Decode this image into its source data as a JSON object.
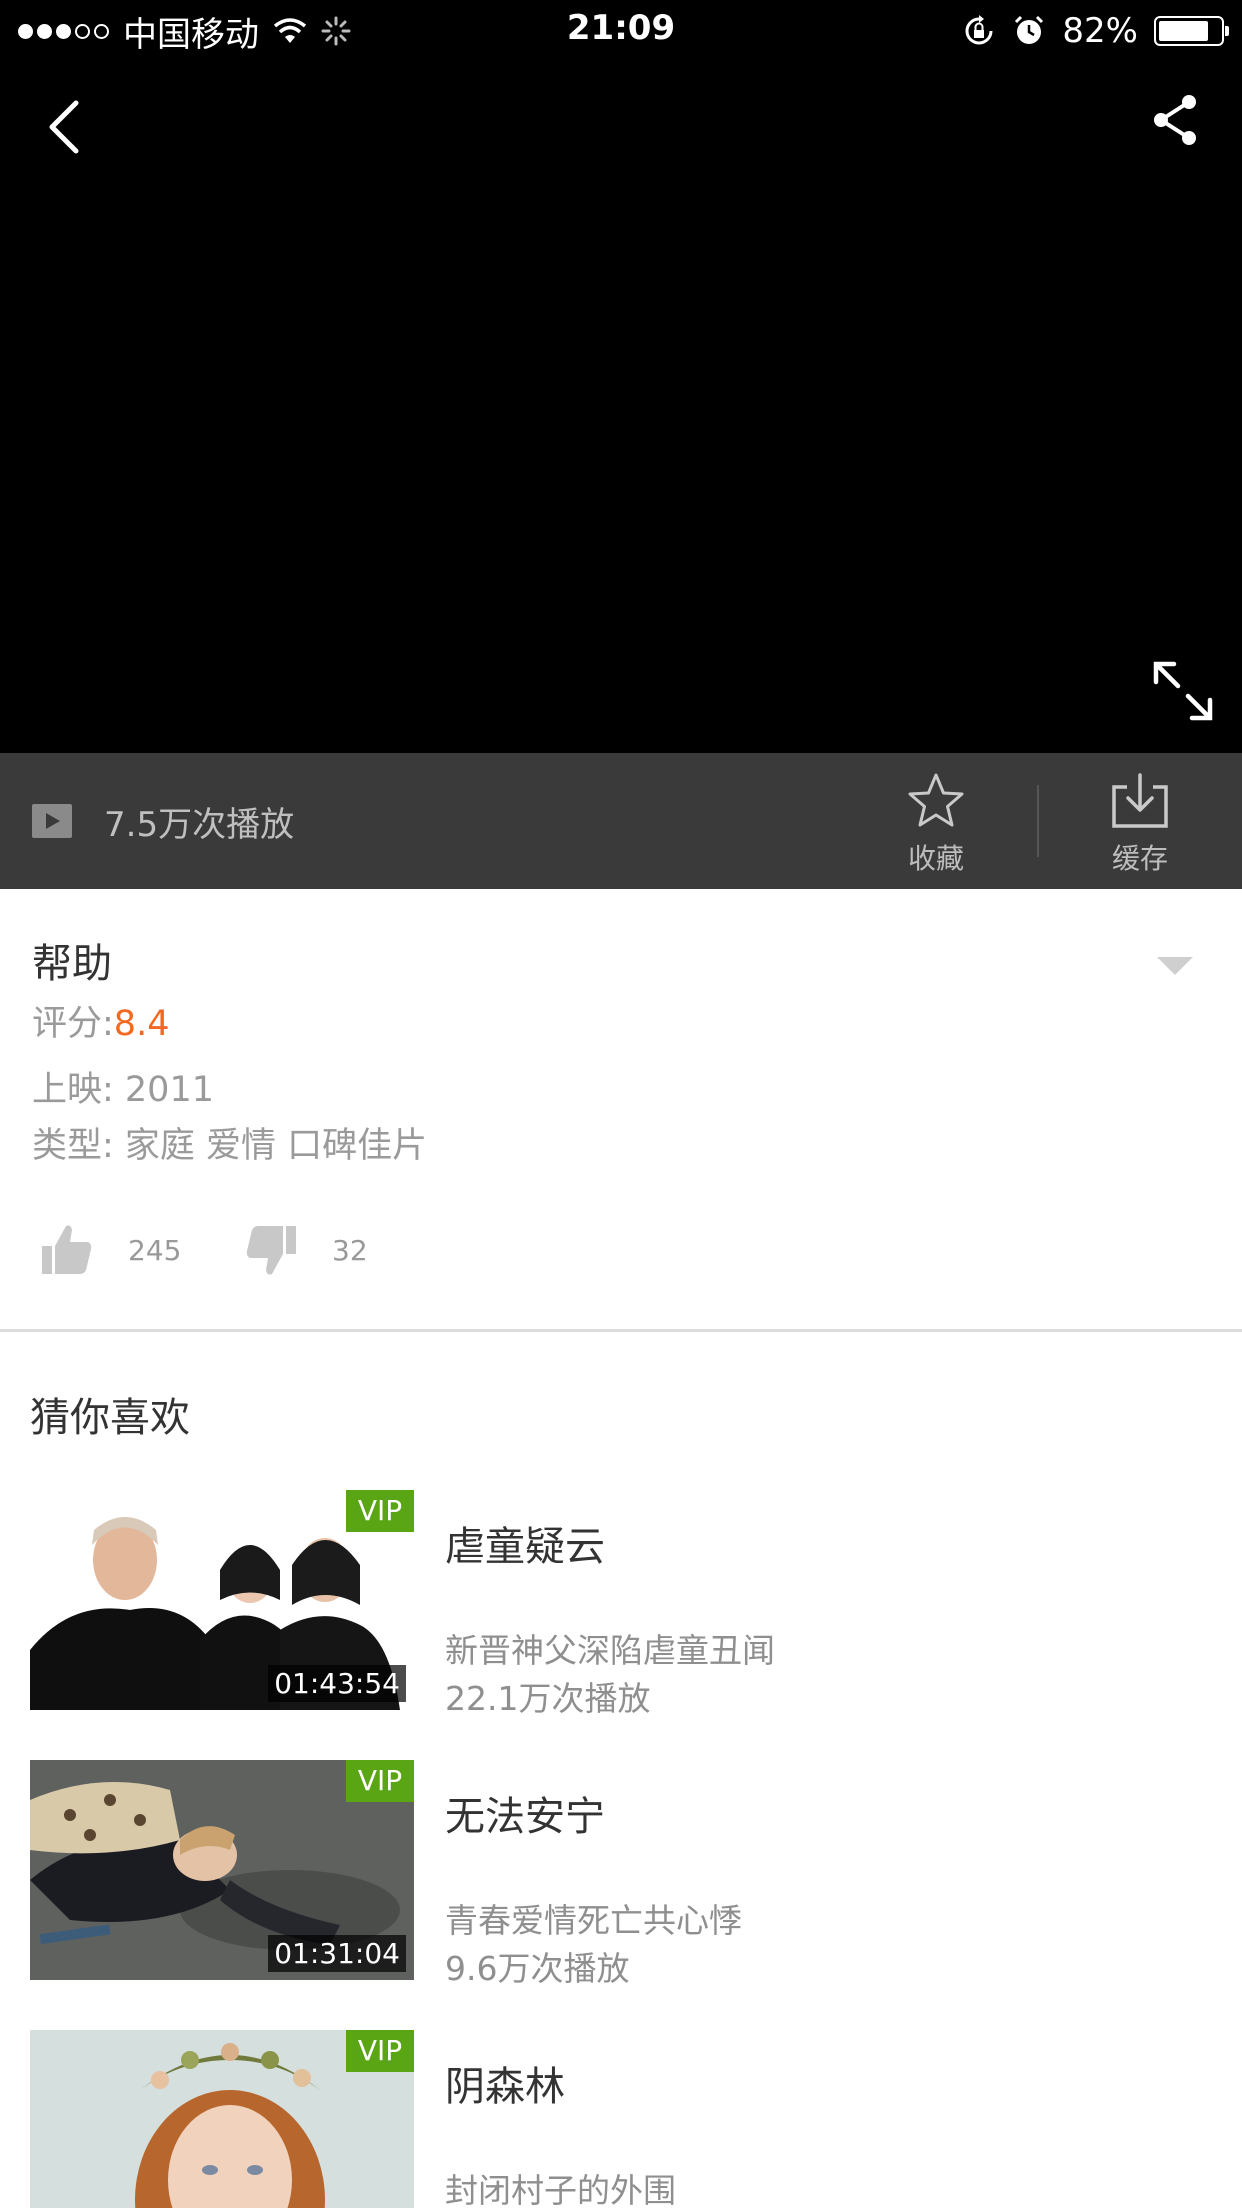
{
  "status_bar": {
    "carrier": "中国移动",
    "time": "21:09",
    "battery": "82%",
    "battery_level": 0.82
  },
  "player": {
    "back_icon": "chevron-left-icon",
    "share_icon": "share-icon",
    "fullscreen_icon": "fullscreen-icon"
  },
  "action_bar": {
    "play_count": "7.5万次播放",
    "favorite_label": "收藏",
    "cache_label": "缓存"
  },
  "details": {
    "title": "帮助",
    "score_label": "评分:",
    "score_value": "8.4",
    "release": "上映: 2011",
    "genre": "类型: 家庭 爱情 口碑佳片",
    "likes": "245",
    "dislikes": "32"
  },
  "recommendations": {
    "section_title": "猜你喜欢",
    "items": [
      {
        "title": "虐童疑云",
        "desc": "新晋神父深陷虐童丑闻",
        "plays": "22.1万次播放",
        "duration": "01:43:54",
        "badge": "VIP"
      },
      {
        "title": "无法安宁",
        "desc": "青春爱情死亡共心悸",
        "plays": "9.6万次播放",
        "duration": "01:31:04",
        "badge": "VIP"
      },
      {
        "title": "阴森林",
        "desc": "封闭村子的外围",
        "plays": "",
        "duration": "",
        "badge": "VIP"
      }
    ]
  },
  "colors": {
    "accent_score": "#f26a21",
    "vip_green": "#5aa514",
    "action_bar_bg": "#3a3a3a"
  }
}
